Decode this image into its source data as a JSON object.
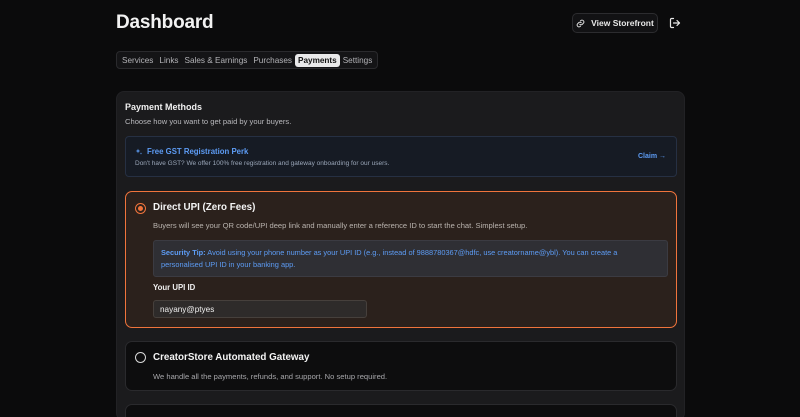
{
  "header": {
    "title": "Dashboard",
    "storefront_label": "View Storefront",
    "storefront_icon": "link-icon",
    "logout_icon": "logout-icon"
  },
  "tabs": [
    {
      "label": "Services",
      "active": false
    },
    {
      "label": "Links",
      "active": false
    },
    {
      "label": "Sales & Earnings",
      "active": false
    },
    {
      "label": "Purchases",
      "active": false
    },
    {
      "label": "Payments",
      "active": true
    },
    {
      "label": "Settings",
      "active": false
    }
  ],
  "payment": {
    "title": "Payment Methods",
    "subtitle": "Choose how you want to get paid by your buyers.",
    "perk": {
      "title": "Free GST Registration Perk",
      "desc": "Don't have GST? We offer 100% free registration and gateway onboarding for our users.",
      "claim": "Claim →",
      "icon": "sparkles-icon"
    },
    "options": [
      {
        "title": "Direct UPI (Zero Fees)",
        "desc": "Buyers will see your QR code/UPI deep link and manually enter a reference ID to start the chat. Simplest setup.",
        "selected": true
      },
      {
        "title": "CreatorStore Automated Gateway",
        "desc": "We handle all the payments, refunds, and support. No setup required.",
        "selected": false
      }
    ],
    "tip_prefix": "Security Tip:",
    "tip_text": "Avoid using your phone number as your UPI ID (e.g., instead of 9888780367@hdfc, use creatorname@ybl). You can create a personalised UPI ID in your banking app.",
    "upi_label": "Your UPI ID",
    "upi_value": "nayany@ptyes"
  },
  "colors": {
    "accent": "#f0743c",
    "link": "#5d9cf5",
    "background": "#0b0b0c"
  }
}
